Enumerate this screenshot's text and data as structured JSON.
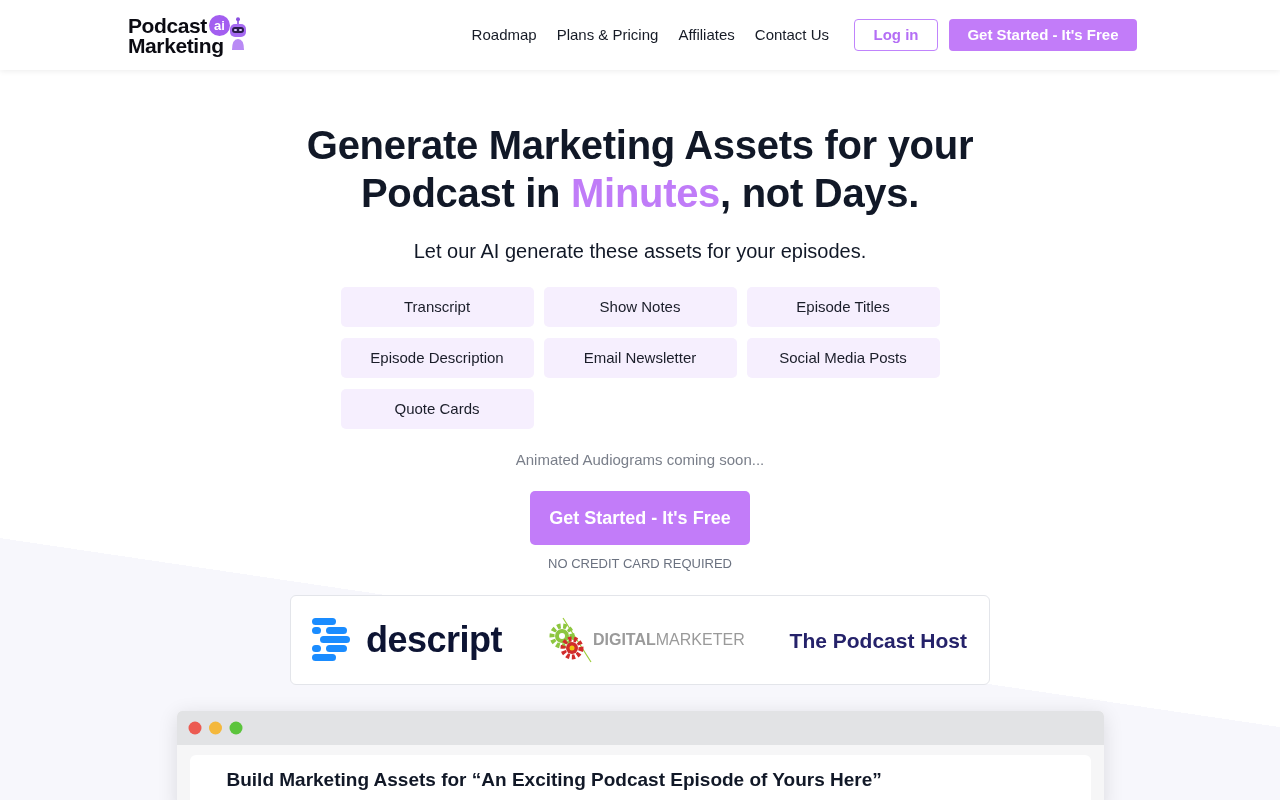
{
  "header": {
    "logo": {
      "lines": [
        "Podcast",
        "Marketing"
      ],
      "badge": "ai"
    },
    "nav_links": [
      "Roadmap",
      "Plans & Pricing",
      "Affiliates",
      "Contact Us"
    ],
    "login_button": "Log in",
    "signup_button": "Get Started - It's Free"
  },
  "hero": {
    "headline": {
      "lines": [
        [
          {
            "text": "Generate Marketing Assets for your",
            "highlight": false
          }
        ],
        [
          {
            "text": "Podcast in ",
            "highlight": false
          },
          {
            "text": "Minutes",
            "highlight": true
          },
          {
            "text": ", not Days.",
            "highlight": false
          }
        ]
      ]
    },
    "subtitle": "Let our AI generate these assets for your episodes.",
    "assets": [
      "Transcript",
      "Show Notes",
      "Episode Titles",
      "Episode Description",
      "Email Newsletter",
      "Social Media Posts",
      "Quote Cards"
    ],
    "coming_soon": "Animated Audiograms coming soon...",
    "cta_button": "Get Started - It's Free",
    "cta_note": "NO CREDIT CARD REQUIRED"
  },
  "partner_logos": [
    {
      "kind": "stripes",
      "text": "descript"
    },
    {
      "kind": "gears",
      "text": "**DIGITAL**MARKETER"
    },
    {
      "kind": "wordmark",
      "text": "The Podcast Host"
    }
  ],
  "preview_window": {
    "heading": "Build Marketing Assets for “An Exciting Podcast Episode of Yours Here”"
  }
}
